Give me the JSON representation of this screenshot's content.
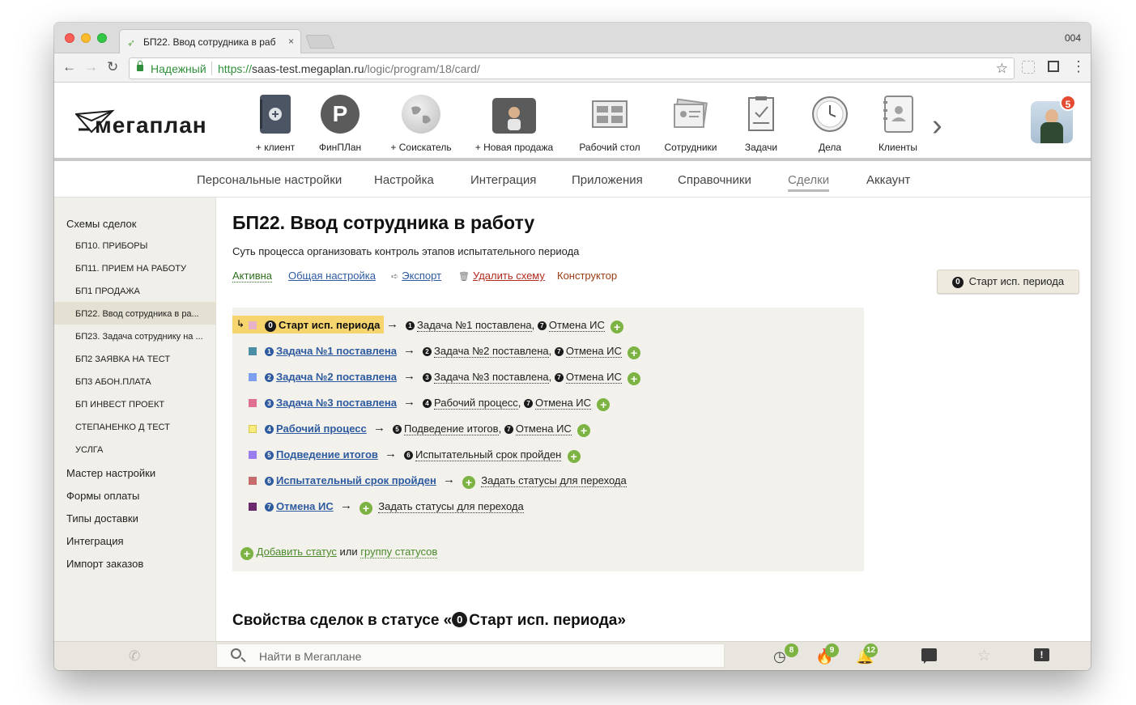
{
  "browser": {
    "tab_title": "БП22. Ввод сотрудника в раб",
    "window_number": "004",
    "secure_label": "Надежный",
    "url_scheme": "https://",
    "url_host": "saas-test.megaplan.ru",
    "url_path": "/logic/program/18/card/"
  },
  "header": {
    "logo_text": "мегаплан",
    "apps": [
      {
        "label": "+ клиент",
        "icon": "add-client-icon"
      },
      {
        "label": "ФинПЛан",
        "icon": "finplan-icon"
      },
      {
        "label": "+ Соискатель",
        "icon": "globe-icon"
      },
      {
        "label": "+ Новая продажа",
        "icon": "briefcase-icon"
      },
      {
        "label": "Рабочий стол",
        "icon": "desktop-icon"
      },
      {
        "label": "Сотрудники",
        "icon": "employees-icon"
      },
      {
        "label": "Задачи",
        "icon": "tasks-icon"
      },
      {
        "label": "Дела",
        "icon": "clock-icon"
      },
      {
        "label": "Клиенты",
        "icon": "clients-icon"
      }
    ],
    "finplan_letter": "P",
    "notification_count": "5"
  },
  "subnav": {
    "items": [
      "Персональные настройки",
      "Настройка",
      "Интеграция",
      "Приложения",
      "Справочники",
      "Сделки",
      "Аккаунт"
    ],
    "active": "Сделки"
  },
  "sidebar": {
    "schemes_title": "Схемы сделок",
    "schemes": [
      "БП10. ПРИБОРЫ",
      "БП11. ПРИЕМ НА РАБОТУ",
      "БП1 ПРОДАЖА",
      "БП22. Ввод сотрудника в ра...",
      "БП23. Задача сотруднику на ...",
      "БП2 ЗАЯВКА НА ТЕСТ",
      "БП3 АБОН.ПЛАТА",
      "БП ИНВЕСТ ПРОЕКТ",
      "СТЕПАНЕНКО Д ТЕСТ",
      "УСЛГА"
    ],
    "other_items": [
      "Мастер настройки",
      "Формы оплаты",
      "Типы доставки",
      "Интеграция",
      "Импорт заказов"
    ]
  },
  "page": {
    "title": "БП22. Ввод сотрудника в работу",
    "description": "Суть процесса организовать контроль этапов испытательного периода",
    "actions": {
      "active": "Активна",
      "general": "Общая настройка",
      "export": "Экспорт",
      "delete": "Удалить схему",
      "constructor": "Конструктор"
    },
    "current_status_button": "Старт исп. периода",
    "arrow": "→",
    "comma": ",",
    "statuses": [
      {
        "num": "0",
        "name": "Старт исп. периода",
        "color": "#e8b3c8",
        "targets": [
          {
            "num": "1",
            "name": "Задача №1 поставлена"
          },
          {
            "num": "7",
            "name": "Отмена ИС"
          }
        ]
      },
      {
        "num": "1",
        "name": "Задача №1 поставлена",
        "color": "#4a8fa3",
        "targets": [
          {
            "num": "2",
            "name": "Задача №2 поставлена"
          },
          {
            "num": "7",
            "name": "Отмена ИС"
          }
        ]
      },
      {
        "num": "2",
        "name": "Задача №2 поставлена",
        "color": "#7e9ef0",
        "targets": [
          {
            "num": "3",
            "name": "Задача №3 поставлена"
          },
          {
            "num": "7",
            "name": "Отмена ИС"
          }
        ]
      },
      {
        "num": "3",
        "name": "Задача №3 поставлена",
        "color": "#e0708f",
        "targets": [
          {
            "num": "4",
            "name": "Рабочий процесс"
          },
          {
            "num": "7",
            "name": "Отмена ИС"
          }
        ]
      },
      {
        "num": "4",
        "name": "Рабочий процесс",
        "color": "#f7ea80",
        "targets": [
          {
            "num": "5",
            "name": "Подведение итогов"
          },
          {
            "num": "7",
            "name": "Отмена ИС"
          }
        ]
      },
      {
        "num": "5",
        "name": "Подведение итогов",
        "color": "#9a7ef0",
        "targets": [
          {
            "num": "6",
            "name": "Испытательный срок пройден"
          }
        ]
      },
      {
        "num": "6",
        "name": "Испытательный срок пройден",
        "color": "#c76c6c",
        "targets": [
          {
            "num": "",
            "name": "Задать статусы для перехода"
          }
        ]
      },
      {
        "num": "7",
        "name": "Отмена ИС",
        "color": "#6b2a6b",
        "targets": [
          {
            "num": "",
            "name": "Задать статусы для перехода"
          }
        ]
      }
    ],
    "add_status": "Добавить статус",
    "or": "или",
    "group_statuses": "группу статусов",
    "properties_prefix": "Свойства сделок в статусе «",
    "properties_num": "0",
    "properties_name": "Старт исп. периода",
    "properties_suffix": "»"
  },
  "bottombar": {
    "search_placeholder": "Найти в Мегаплане",
    "overdue_count": "8",
    "hot_count": "9",
    "notifications_count": "12"
  }
}
